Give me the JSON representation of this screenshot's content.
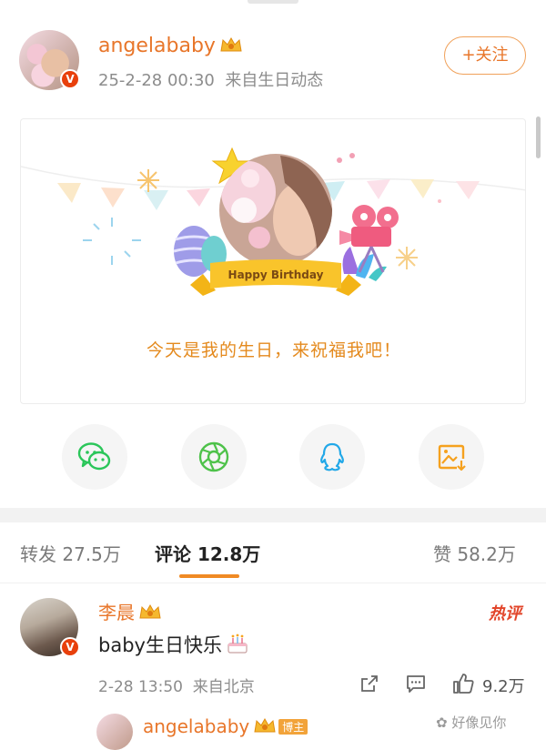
{
  "post": {
    "author": "angelababy",
    "time": "25-2-28 00:30",
    "source": "来自生日动态",
    "follow_label": "+关注"
  },
  "card": {
    "banner_text": "Happy Birthday",
    "message": "今天是我的生日，来祝福我吧！"
  },
  "share_buttons": [
    {
      "icon": "wechat-icon"
    },
    {
      "icon": "moments-icon"
    },
    {
      "icon": "qq-icon"
    },
    {
      "icon": "save-image-icon"
    }
  ],
  "tabs": {
    "repost": "转发 27.5万",
    "comment": "评论 12.8万",
    "like": "赞 58.2万"
  },
  "comment": {
    "author": "李晨",
    "badge": "热评",
    "text": "baby生日快乐",
    "time": "2-28 13:50",
    "location": "来自北京",
    "likes": "9.2万"
  },
  "reply": {
    "author": "angelababy",
    "tag": "博主"
  },
  "watermark": "好像见你",
  "colors": {
    "accent": "#e8762a",
    "hot": "#e2452a",
    "underline": "#f08a24"
  }
}
